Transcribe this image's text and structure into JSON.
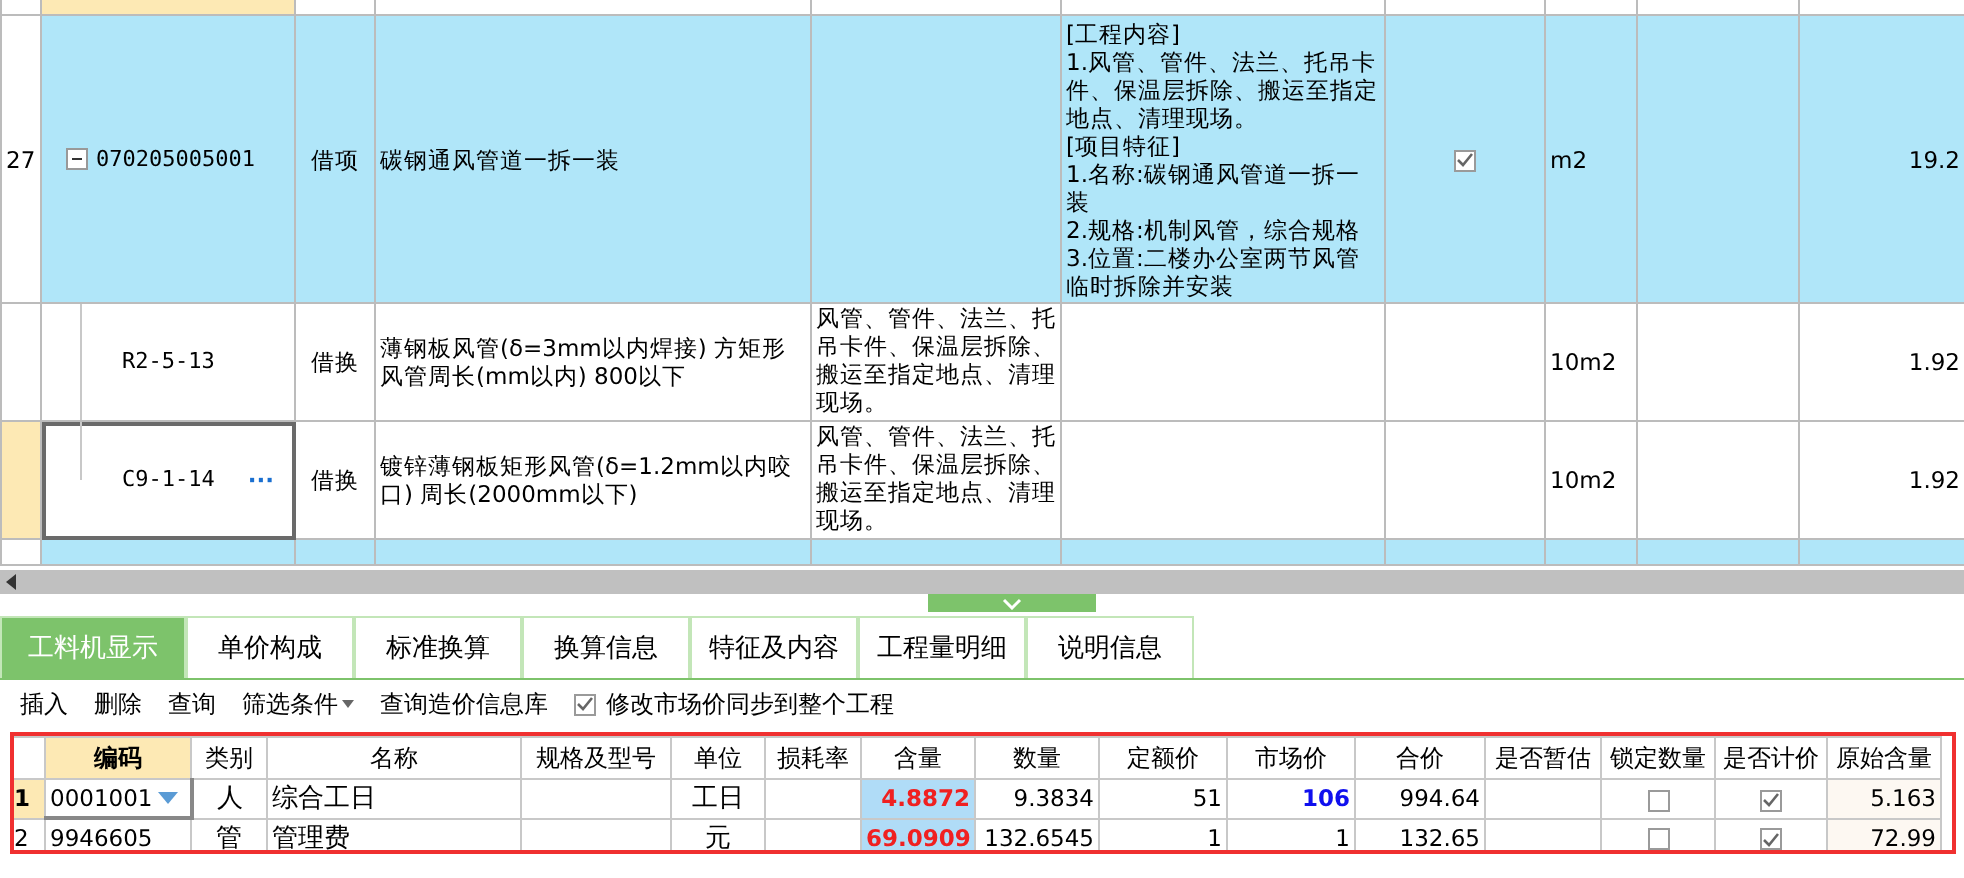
{
  "upper_table": {
    "rows": [
      {
        "kind": "item",
        "row_number": "27",
        "code": "070205005001",
        "expanded": true,
        "selected": false,
        "type": "借项",
        "name": "碳钢通风管道一拆一装",
        "features": "[工程内容]\n1.风管、管件、法兰、托吊卡件、保温层拆除、搬运至指定地点、清理现场。\n[项目特征]\n1.名称:碳钢通风管道一拆一装\n2.规格:机制风管，综合规格\n3.位置:二楼办公室两节风管临时拆除并安装",
        "checked": true,
        "unit": "m2",
        "quantity": "19.2",
        "children": [
          {
            "kind": "sub",
            "code": "R2-5-13",
            "selected": false,
            "type": "借换",
            "name": "薄钢板风管(δ=3mm以内焊接) 方矩形风管周长(mm以内) 800以下",
            "work_content": "风管、管件、法兰、托吊卡件、保温层拆除、搬运至指定地点、清理现场。",
            "unit": "10m2",
            "quantity": "1.92"
          },
          {
            "kind": "sub",
            "code": "C9-1-14",
            "selected": true,
            "more": "···",
            "type": "借换",
            "name": "镀锌薄钢板矩形风管(δ=1.2mm以内咬口) 周长(2000mm以下)",
            "work_content": "风管、管件、法兰、托吊卡件、保温层拆除、搬运至指定地点、清理现场。",
            "unit": "10m2",
            "quantity": "1.92"
          }
        ]
      },
      {
        "kind": "item",
        "selected": false
      }
    ]
  },
  "tabs": [
    {
      "label": "工料机显示",
      "selected": true
    },
    {
      "label": "单价构成",
      "selected": false
    },
    {
      "label": "标准换算",
      "selected": false
    },
    {
      "label": "换算信息",
      "selected": false
    },
    {
      "label": "特征及内容",
      "selected": false
    },
    {
      "label": "工程量明细",
      "selected": false
    },
    {
      "label": "说明信息",
      "selected": false
    }
  ],
  "toolbar": [
    {
      "kind": "button",
      "label": "插入"
    },
    {
      "kind": "button",
      "label": "删除"
    },
    {
      "kind": "button",
      "label": "查询"
    },
    {
      "kind": "dropdown",
      "label": "筛选条件"
    },
    {
      "kind": "button",
      "label": "查询造价信息库"
    },
    {
      "kind": "checkbox",
      "label": "修改市场价同步到整个工程",
      "checked": true
    }
  ],
  "resource_table": {
    "columns": [
      "编码",
      "类别",
      "名称",
      "规格及型号",
      "单位",
      "损耗率",
      "含量",
      "数量",
      "定额价",
      "市场价",
      "合价",
      "是否暂估",
      "锁定数量",
      "是否计价",
      "原始含量"
    ],
    "rows": [
      {
        "row_number": "1",
        "selected": true,
        "code": "0001001",
        "type": "人",
        "name": "综合工日",
        "unit": "工日",
        "content": "4.8872",
        "quantity": "9.3834",
        "quota_price": "51",
        "market_price": "106",
        "market_price_modified": true,
        "total": "994.64",
        "locked": false,
        "priced": true,
        "original_content": "5.163"
      },
      {
        "row_number": "2",
        "selected": false,
        "code": "9946605",
        "type": "管",
        "name": "管理费",
        "unit": "元",
        "content": "69.0909",
        "quantity": "132.6545",
        "quota_price": "1",
        "market_price": "1",
        "market_price_modified": false,
        "total": "132.65",
        "locked": false,
        "priced": true,
        "original_content": "72.99"
      }
    ]
  }
}
